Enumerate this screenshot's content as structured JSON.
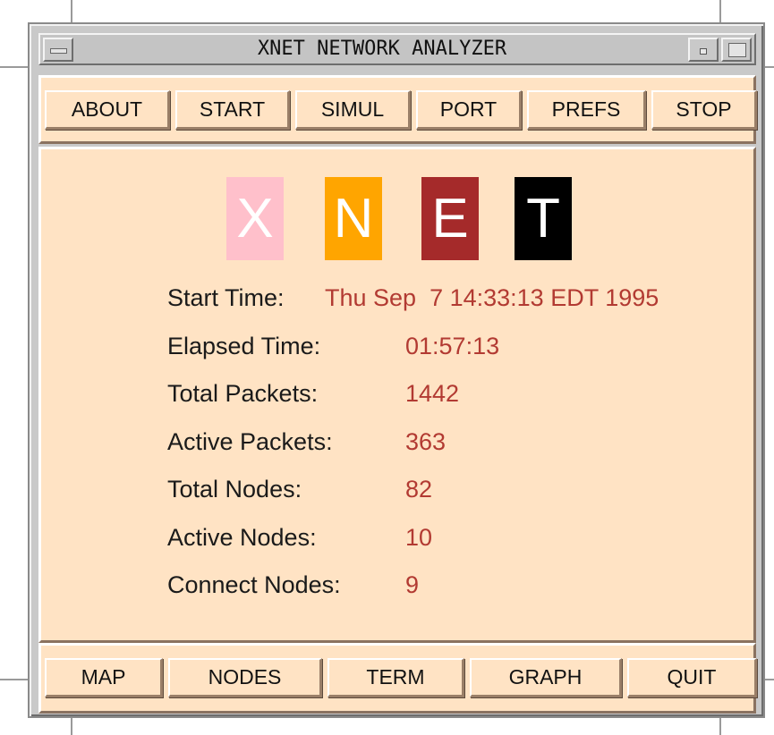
{
  "window": {
    "title": "XNET NETWORK ANALYZER"
  },
  "toolbar": {
    "buttons": [
      "ABOUT",
      "START",
      "SIMUL",
      "PORT",
      "PREFS",
      "STOP"
    ]
  },
  "logo": {
    "letters": [
      "X",
      "N",
      "E",
      "T"
    ],
    "colors": [
      "#ffc0cb",
      "#ffa500",
      "#a52a2a",
      "#000000"
    ]
  },
  "stats": {
    "start_time_label": "Start Time:",
    "start_time_value": "Thu Sep  7 14:33:13 EDT 1995",
    "elapsed_time_label": "Elapsed Time:",
    "elapsed_time_value": "01:57:13",
    "total_packets_label": "Total Packets:",
    "total_packets_value": "1442",
    "active_packets_label": "Active Packets:",
    "active_packets_value": "363",
    "total_nodes_label": "Total Nodes:",
    "total_nodes_value": "82",
    "active_nodes_label": "Active Nodes:",
    "active_nodes_value": "10",
    "connect_nodes_label": "Connect Nodes:",
    "connect_nodes_value": "9"
  },
  "bottombar": {
    "buttons": [
      "MAP",
      "NODES",
      "TERM",
      "GRAPH",
      "QUIT"
    ]
  },
  "colors": {
    "panel_bg": "#ffe3c4",
    "value_text": "#b23a32"
  }
}
